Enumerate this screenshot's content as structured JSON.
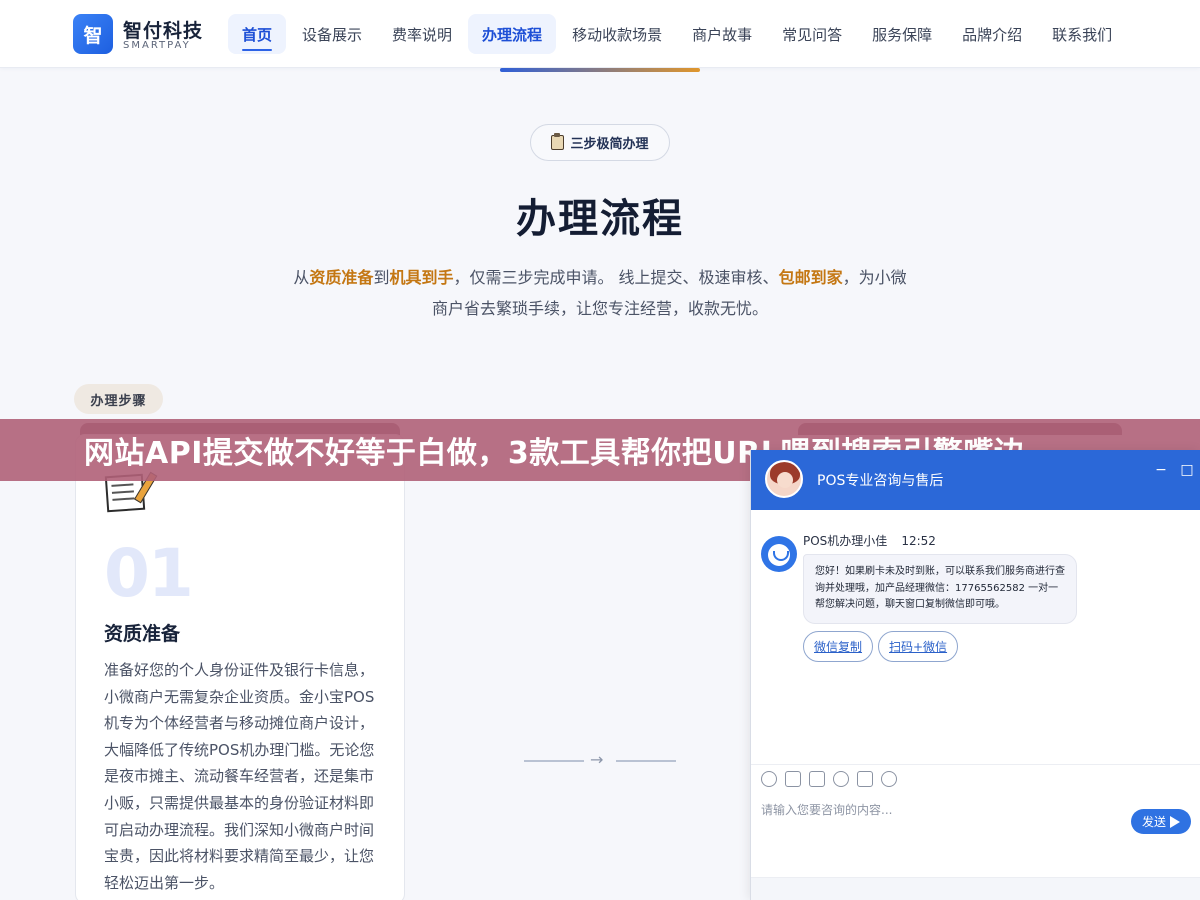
{
  "brand": {
    "mark": "智",
    "name": "智付科技",
    "sub": "SMARTPAY"
  },
  "nav": {
    "items": [
      {
        "label": "首页"
      },
      {
        "label": "设备展示"
      },
      {
        "label": "费率说明"
      },
      {
        "label": "办理流程"
      },
      {
        "label": "移动收款场景"
      },
      {
        "label": "商户故事"
      },
      {
        "label": "常见问答"
      },
      {
        "label": "服务保障"
      },
      {
        "label": "品牌介绍"
      },
      {
        "label": "联系我们"
      }
    ],
    "active_index": 3
  },
  "hero": {
    "badge": "三步极简办理",
    "title": "办理流程",
    "intro_parts": {
      "p1": "从",
      "h1": "资质准备",
      "p2": "到",
      "h2": "机具到手",
      "p3": "，仅需三步完成申请。 线上提交、极速审核、",
      "h3": "包邮到家",
      "p4": "，为小微商户省去繁琐手续，让您专注经营，收款无忧。"
    }
  },
  "steps": {
    "tag": "办理步骤",
    "cards": [
      {
        "num": "01",
        "title": "资质准备",
        "desc": "准备好您的个人身份证件及银行卡信息，小微商户无需复杂企业资质。金小宝POS机专为个体经营者与移动摊位商户设计，大幅降低了传统POS机办理门槛。无论您是夜市摊主、流动餐车经营者，还是集市小贩，只需提供最基本的身份验证材料即可启动办理流程。我们深知小微商户时间宝贵，因此将材料要求精简至最少，让您轻松迈出第一步。"
      }
    ],
    "connector_arrow": "→"
  },
  "banner": {
    "text": "网站API提交做不好等于白做，3款工具帮你把URL喂到搜索引擎嘴边"
  },
  "chat": {
    "title": "POS专业咨询与售后",
    "minimize_icon": "−",
    "close_icon": "□",
    "agent_name": "POS机办理小佳",
    "time": "12:52",
    "message": "您好！如果刷卡未及时到账，可以联系我们服务商进行查询并处理哦，加产品经理微信：17765562582 一对一帮您解决问题，聊天窗口复制微信即可哦。",
    "quick_replies": [
      {
        "label": "微信复制"
      },
      {
        "label": "扫码+微信"
      }
    ],
    "tools": [
      "emoji-icon",
      "image-icon",
      "screenshot-icon",
      "rating-icon",
      "voice-icon",
      "wechat-icon"
    ],
    "input_placeholder": "请输入您要咨询的内容...",
    "send_label": "发送"
  },
  "colors": {
    "primary": "#2b68d8",
    "accent_orange": "#c47713",
    "banner_bg": "#b06078",
    "nav_active_bg": "#eef3fe"
  }
}
